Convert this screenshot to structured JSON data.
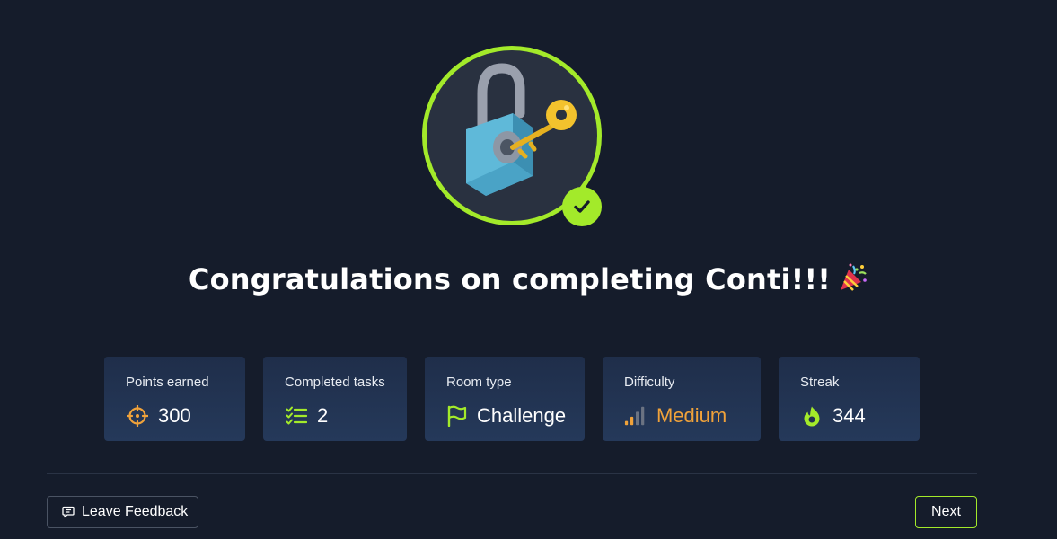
{
  "completion": {
    "title": "Congratulations on completing Conti!!!",
    "room_icon": "lock-with-key-icon",
    "badge_icon": "checkmark-icon",
    "celebration_icon": "party-popper-icon"
  },
  "stats": [
    {
      "label": "Points earned",
      "value": "300",
      "icon": "crosshair-target-icon"
    },
    {
      "label": "Completed tasks",
      "value": "2",
      "icon": "checklist-icon"
    },
    {
      "label": "Room type",
      "value": "Challenge",
      "icon": "flag-icon"
    },
    {
      "label": "Difficulty",
      "value": "Medium",
      "icon": "signal-bars-icon"
    },
    {
      "label": "Streak",
      "value": "344",
      "icon": "flame-icon"
    }
  ],
  "footer": {
    "feedback_label": "Leave Feedback",
    "next_label": "Next"
  },
  "colors": {
    "background": "#151c2b",
    "accent": "#a3ea2a",
    "points": "#f0a23a",
    "difficulty": "#f0a23a",
    "card": "#22324f"
  }
}
